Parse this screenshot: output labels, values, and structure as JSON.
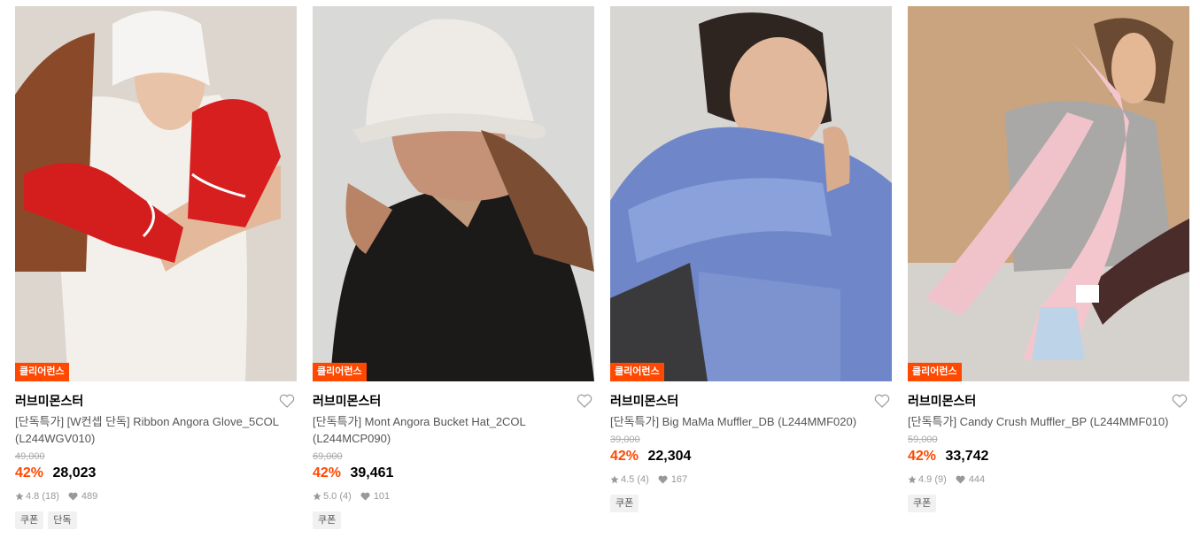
{
  "colors": {
    "accent": "#ff4800",
    "badge_bg": "#ff4800",
    "muted": "#999999"
  },
  "products": [
    {
      "badge": "클리어런스",
      "brand": "러브미몬스터",
      "name": "[단독특가] [W컨셉 단독] Ribbon Angora Glove_5COL (L244WGV010)",
      "original_price": "49,000",
      "discount": "42%",
      "price": "28,023",
      "rating": "4.8",
      "reviews": "(18)",
      "likes": "489",
      "tags": [
        "쿠폰",
        "단독"
      ]
    },
    {
      "badge": "클리어런스",
      "brand": "러브미몬스터",
      "name": "[단독특가] Mont Angora Bucket Hat_2COL (L244MCP090)",
      "original_price": "69,000",
      "discount": "42%",
      "price": "39,461",
      "rating": "5.0",
      "reviews": "(4)",
      "likes": "101",
      "tags": [
        "쿠폰"
      ]
    },
    {
      "badge": "클리어런스",
      "brand": "러브미몬스터",
      "name": "[단독특가] Big MaMa Muffler_DB (L244MMF020)",
      "original_price": "39,000",
      "discount": "42%",
      "price": "22,304",
      "rating": "4.5",
      "reviews": "(4)",
      "likes": "167",
      "tags": [
        "쿠폰"
      ]
    },
    {
      "badge": "클리어런스",
      "brand": "러브미몬스터",
      "name": "[단독특가] Candy Crush Muffler_BP (L244MMF010)",
      "original_price": "59,000",
      "discount": "42%",
      "price": "33,742",
      "rating": "4.9",
      "reviews": "(9)",
      "likes": "444",
      "tags": [
        "쿠폰"
      ]
    }
  ]
}
